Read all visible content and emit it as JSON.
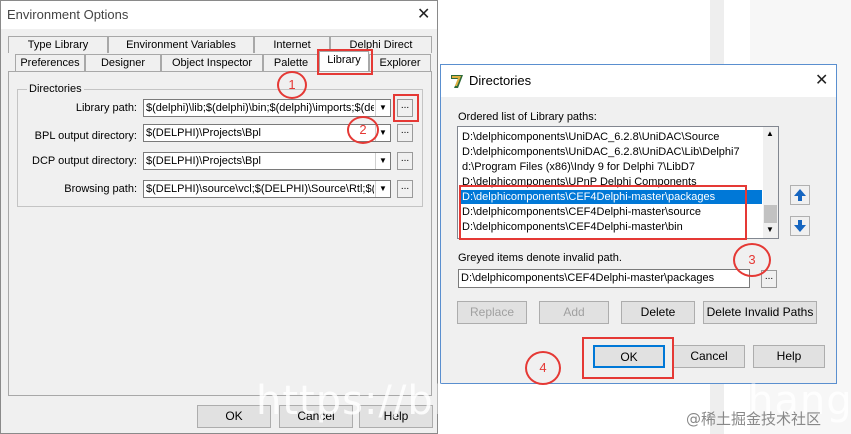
{
  "env_dialog": {
    "title": "Environment Options",
    "tabs_row1": [
      "Type Library",
      "Environment Variables",
      "Internet",
      "Delphi Direct"
    ],
    "tabs_row2": [
      "Preferences",
      "Designer",
      "Object Inspector",
      "Palette",
      "Library",
      "Explorer"
    ],
    "active_tab": "Library",
    "group_label": "Directories",
    "fields": [
      {
        "label": "Library path:",
        "value": "$(delphi)\\lib;$(delphi)\\bin;$(delphi)\\imports;$(delp"
      },
      {
        "label": "BPL output directory:",
        "value": "$(DELPHI)\\Projects\\Bpl"
      },
      {
        "label": "DCP output directory:",
        "value": "$(DELPHI)\\Projects\\Bpl"
      },
      {
        "label": "Browsing path:",
        "value": "$(DELPHI)\\source\\vcl;$(DELPHI)\\Source\\Rtl;$(D"
      }
    ],
    "ok_label": "OK",
    "cancel_label": "Cancel",
    "help_label": "Help"
  },
  "dir_dialog": {
    "title": "Directories",
    "list_label": "Ordered list of Library paths:",
    "items": [
      "D:\\delphicomponents\\UniDAC_6.2.8\\UniDAC\\Source",
      "D:\\delphicomponents\\UniDAC_6.2.8\\UniDAC\\Lib\\Delphi7",
      "d:\\Program Files (x86)\\Indy 9 for Delphi 7\\LibD7",
      "D:\\delphicomponents\\UPnP Delphi Components",
      "D:\\delphicomponents\\CEF4Delphi-master\\packages",
      "D:\\delphicomponents\\CEF4Delphi-master\\source",
      "D:\\delphicomponents\\CEF4Delphi-master\\bin"
    ],
    "selected_index": 4,
    "hint": "Greyed items denote invalid path.",
    "path_value": "D:\\delphicomponents\\CEF4Delphi-master\\packages",
    "buttons": {
      "replace": "Replace",
      "add": "Add",
      "delete": "Delete",
      "delete_invalid": "Delete Invalid Paths"
    },
    "ok_label": "OK",
    "cancel_label": "Cancel",
    "help_label": "Help"
  },
  "annotations": [
    "1",
    "2",
    "3",
    "4"
  ],
  "watermark": {
    "left": "https://blog",
    "right": "zhang",
    "brand": "@稀土掘金技术社区"
  },
  "colors": {
    "selection": "#0078d7",
    "annotation_red": "#e53935",
    "arrow_blue": "#1565c0"
  }
}
